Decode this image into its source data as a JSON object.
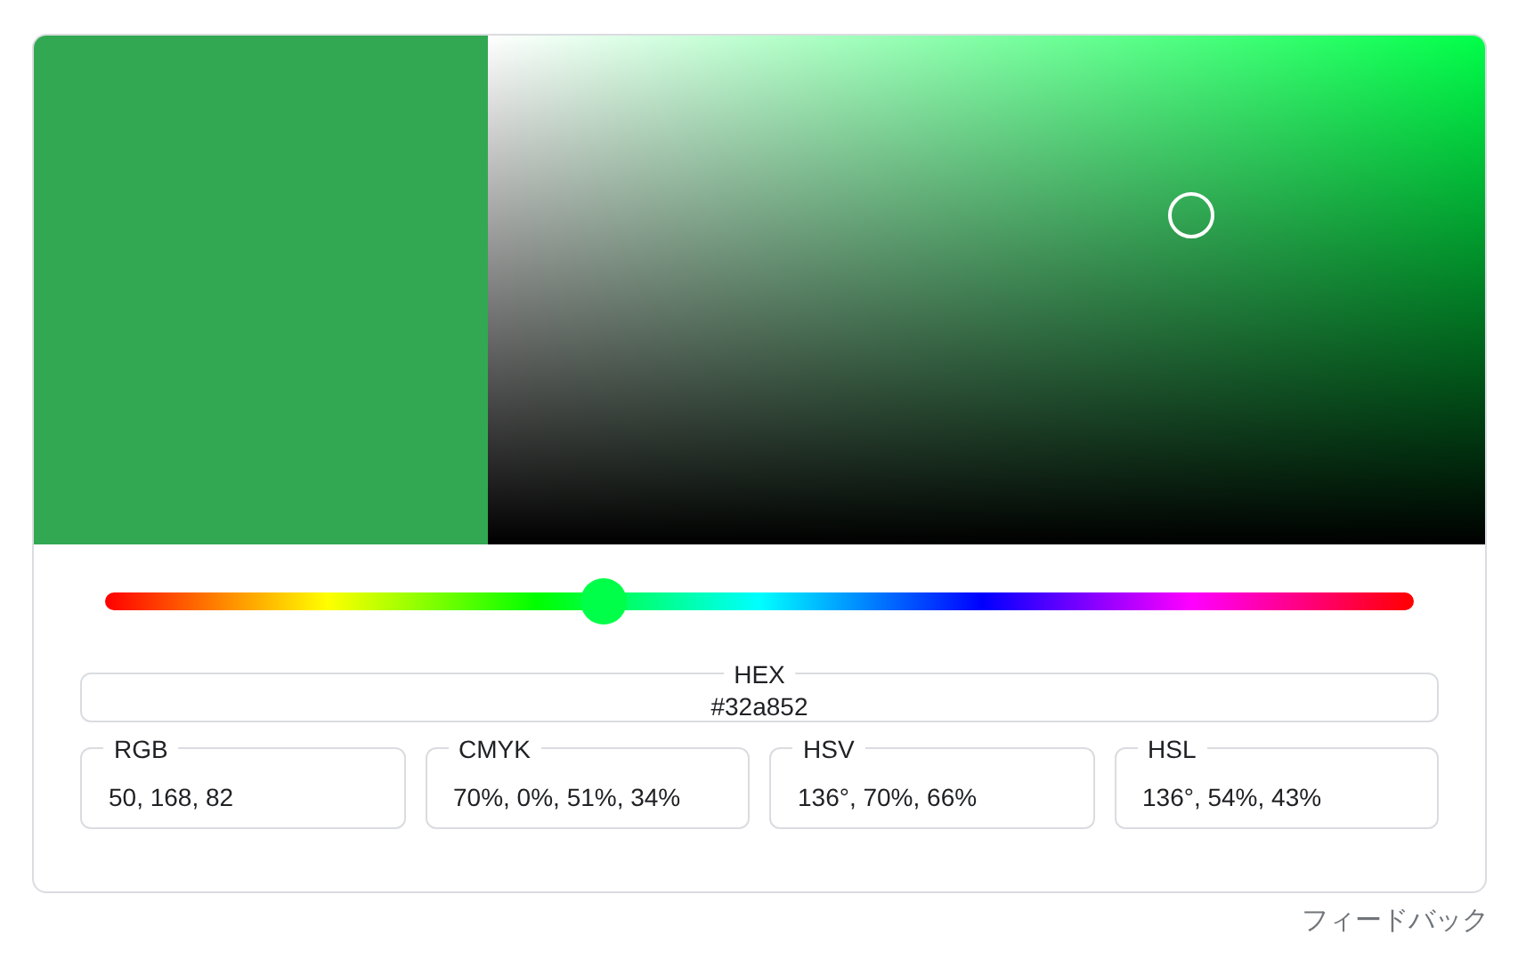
{
  "swatch": {
    "color": "#32a852"
  },
  "picker": {
    "saturation": {
      "level": 0.705
    },
    "value": {
      "level": 0.647
    }
  },
  "hue_slider": {
    "level": 0.381
  },
  "hex": {
    "label": "HEX",
    "value": "#32a852"
  },
  "fields": [
    {
      "label": "RGB",
      "value": "50, 168, 82"
    },
    {
      "label": "CMYK",
      "value": "70%, 0%, 51%, 34%"
    },
    {
      "label": "HSV",
      "value": "136°, 70%, 66%"
    },
    {
      "label": "HSL",
      "value": "136°, 54%, 43%"
    }
  ],
  "feedback": "フィードバック"
}
